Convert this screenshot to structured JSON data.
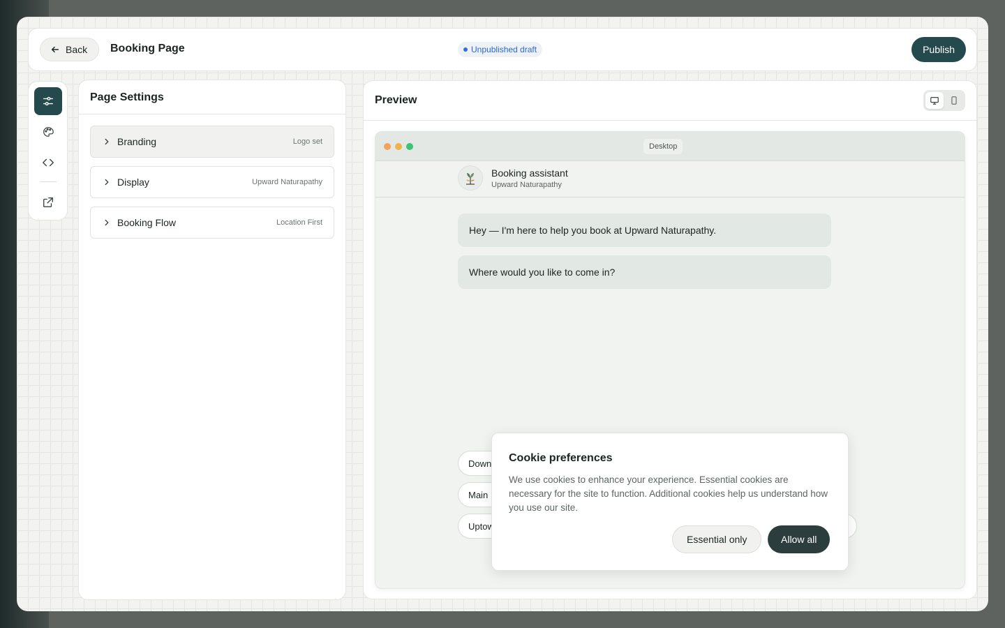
{
  "header": {
    "back_label": "Back",
    "page_title": "Booking Page",
    "status": "Unpublished draft",
    "publish_label": "Publish"
  },
  "rail": {
    "items": [
      {
        "icon": "sliders-icon",
        "active": true
      },
      {
        "icon": "palette-icon",
        "active": false
      },
      {
        "icon": "code-icon",
        "active": false
      },
      {
        "icon": "external-link-icon",
        "active": false
      }
    ]
  },
  "settings": {
    "title": "Page Settings",
    "rows": [
      {
        "label": "Branding",
        "value": "Logo set"
      },
      {
        "label": "Display",
        "value": "Upward Naturapathy"
      },
      {
        "label": "Booking Flow",
        "value": "Location First"
      }
    ]
  },
  "preview": {
    "title": "Preview",
    "device_label": "Desktop",
    "chat": {
      "bot_name": "Booking assistant",
      "bot_sub": "Upward Naturapathy",
      "messages": [
        "Hey — I'm here to help you book at Upward Naturapathy.",
        "Where would you like to come in?"
      ],
      "options": [
        "Down",
        "Main",
        "Uptow"
      ]
    }
  },
  "cookie": {
    "title": "Cookie preferences",
    "body": "We use cookies to enhance your experience. Essential cookies are necessary for the site to function. Additional cookies help us understand how you use our site.",
    "essential_label": "Essential only",
    "allow_label": "Allow all"
  },
  "colors": {
    "accent": "#244a4d",
    "status_blue": "#2a67d6",
    "bubble": "#e2e8e3"
  }
}
